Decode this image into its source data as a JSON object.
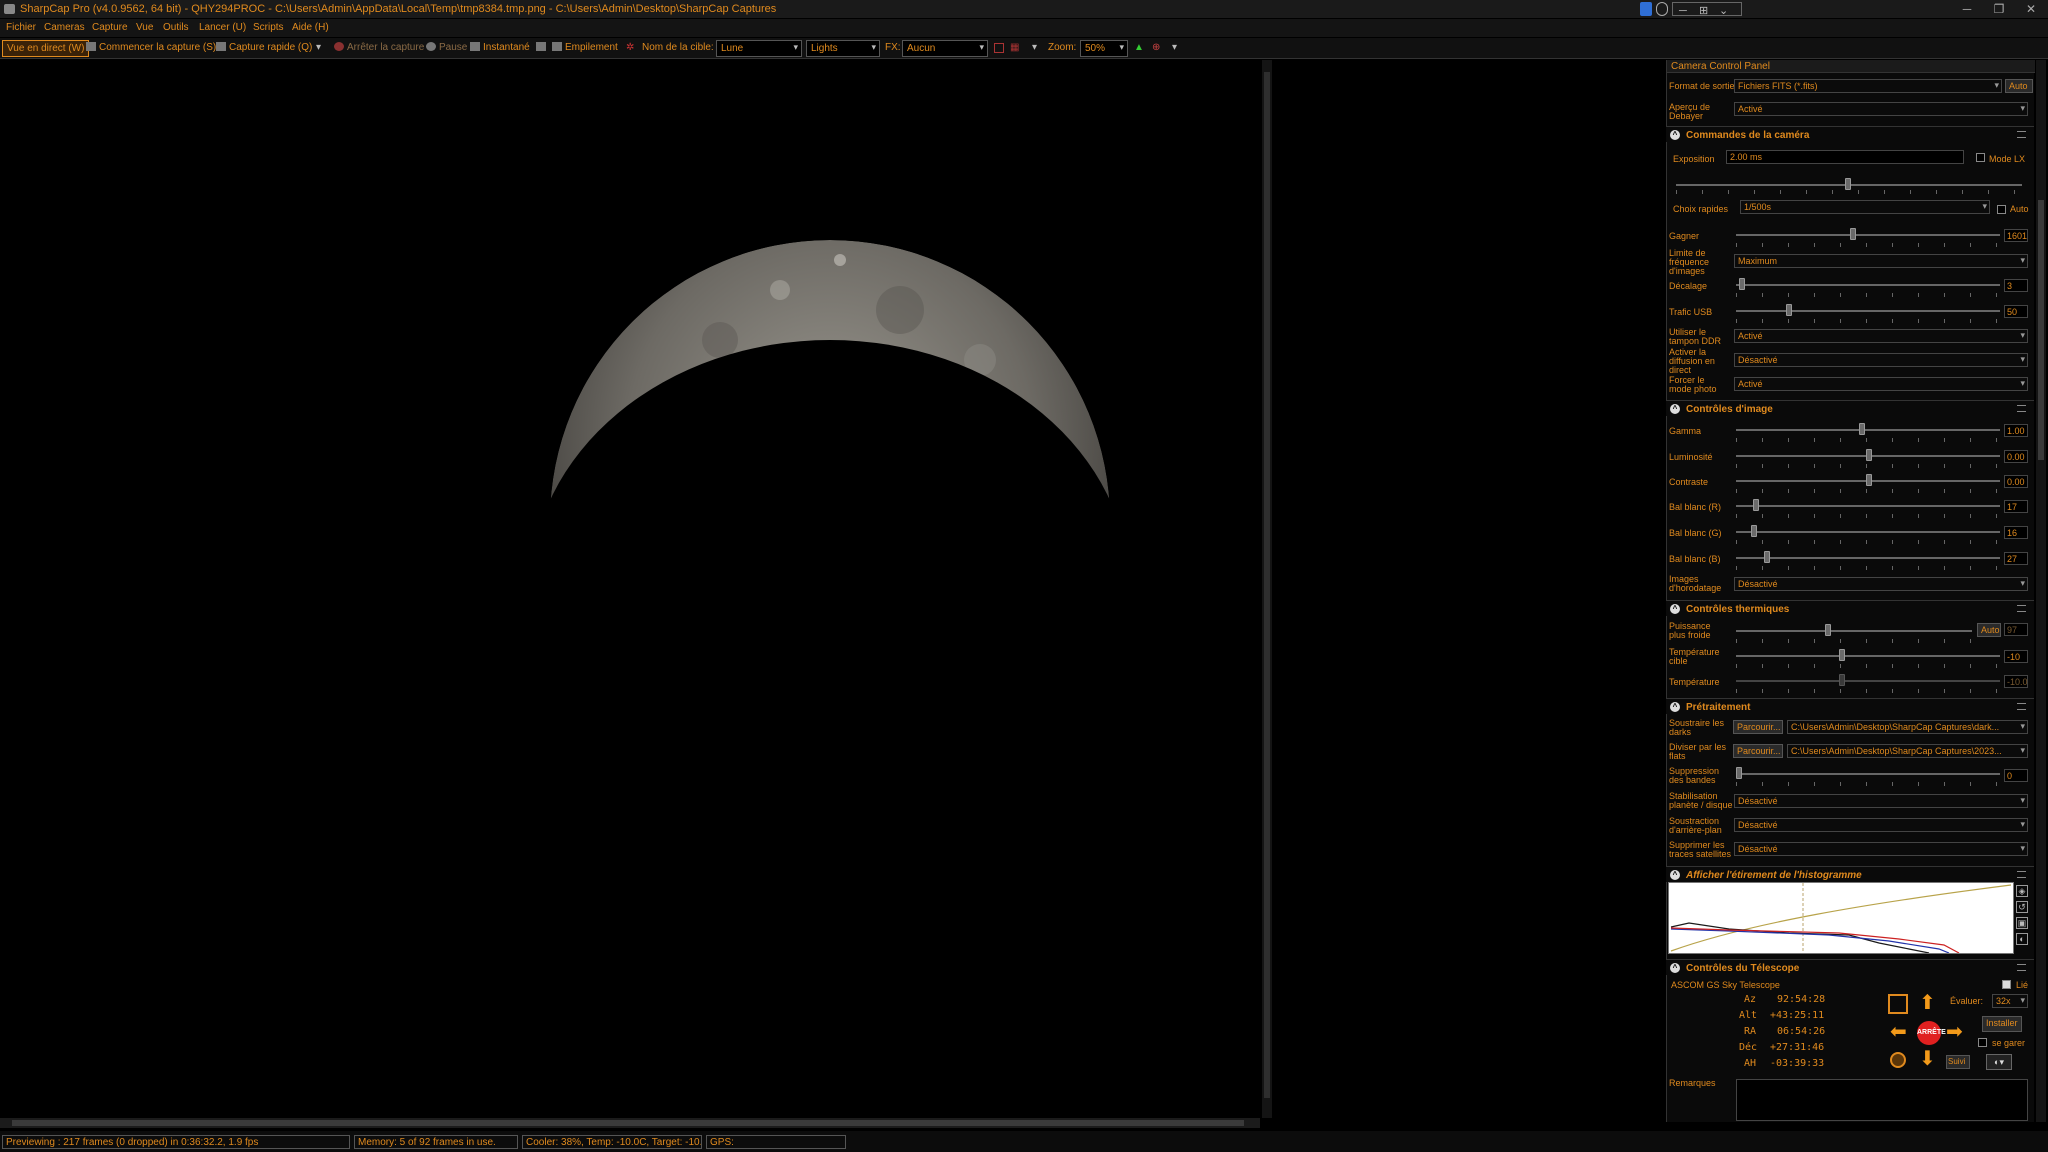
{
  "window": {
    "title": "SharpCap Pro (v4.0.9562, 64 bit) - QHY294PROC - C:\\Users\\Admin\\AppData\\Local\\Temp\\tmp8384.tmp.png - C:\\Users\\Admin\\Desktop\\SharpCap Captures"
  },
  "menu": [
    "Fichier",
    "Cameras",
    "Capture",
    "Vue",
    "Outils",
    "Lancer (U)",
    "Scripts",
    "Aide (H)"
  ],
  "toolbar": {
    "live": "Vue en direct (W)",
    "start": "Commencer la capture (S)",
    "quick": "Capture rapide (Q)",
    "stop": "Arrêter la capture",
    "pause": "Pause",
    "snapshot": "Instantané",
    "stack": "Empilement",
    "target_label": "Nom de la cible:",
    "target": "Lune",
    "frame_type": "Lights",
    "fx_label": "FX:",
    "fx": "Aucun",
    "zoom_label": "Zoom:",
    "zoom": "50%"
  },
  "status": {
    "preview": "Previewing : 217 frames (0 dropped) in 0:36:32.2, 1.9 fps",
    "memory": "Memory: 5 of 92 frames in use.",
    "cooler": "Cooler: 38%, Temp: -10.0C, Target: -10.0C",
    "gps": "GPS:"
  },
  "panel": {
    "title": "Camera Control Panel",
    "output_label": "Format de sortie",
    "output": "Fichiers FITS (*.fits)",
    "auto": "Auto",
    "debayer_label": "Aperçu de Debayer",
    "debayer": "Activé",
    "sec_camera": "Commandes de la caméra",
    "exposure_label": "Exposition",
    "exposure": "2.00 ms",
    "lx_label": "Mode LX",
    "quick_label": "Choix rapides",
    "quick": "1/500s",
    "quick_auto": "Auto",
    "gain_label": "Gagner",
    "gain": "1601",
    "fps_label": "Limite de fréquence d'images",
    "fps": "Maximum",
    "offset_label": "Décalage",
    "offset": "3",
    "usb_label": "Trafic USB",
    "usb": "50",
    "ddr_label": "Utiliser le tampon DDR",
    "ddr": "Activé",
    "stream_label": "Activer la diffusion en direct",
    "stream": "Désactivé",
    "photo_label": "Forcer le mode photo",
    "photo": "Activé",
    "sec_image": "Contrôles d'image",
    "gamma_label": "Gamma",
    "gamma": "1.00",
    "bright_label": "Luminosité",
    "bright": "0.00",
    "contrast_label": "Contraste",
    "contrast": "0.00",
    "wbr_label": "Bal blanc (R)",
    "wbr": "17",
    "wbg_label": "Bal blanc (G)",
    "wbg": "16",
    "wbb_label": "Bal blanc (B)",
    "wbb": "27",
    "ts_label": "Images d'horodatage",
    "ts": "Désactivé",
    "sec_thermal": "Contrôles thermiques",
    "cooler_label": "Puissance plus froide",
    "cooler_auto": "Auto",
    "cooler": "97",
    "target_label": "Température cible",
    "target": "-10",
    "temp_label": "Température",
    "temp": "-10.0",
    "sec_pre": "Prétraitement",
    "darks_label": "Soustraire les darks",
    "browse": "Parcourir...",
    "darks": "C:\\Users\\Admin\\Desktop\\SharpCap Captures\\dark...",
    "flats_label": "Diviser par les flats",
    "flats": "C:\\Users\\Admin\\Desktop\\SharpCap Captures\\2023...",
    "banding_label": "Suppression des bandes",
    "banding": "0",
    "stab_label": "Stabilisation planète / disque",
    "stab": "Désactivé",
    "bg_label": "Soustraction d'arrière-plan",
    "bg": "Désactivé",
    "sat_label": "Supprimer les traces satellites",
    "sat": "Désactivé",
    "sec_hist": "Afficher l'étirement de l'histogramme",
    "sec_tele": "Contrôles du Télescope",
    "mount": "ASCOM GS Sky Telescope",
    "linked": "Lié",
    "az_label": "Az",
    "az": "92:54:28",
    "alt_label": "Alt",
    "alt": "+43:25:11",
    "ra_label": "RA",
    "ra": "06:54:26",
    "dec_label": "Déc",
    "dec": "+27:31:46",
    "ah_label": "AH",
    "ah": "-03:39:33",
    "rate_label": "Évaluer:",
    "rate": "32x",
    "stop": "ARRÊTE",
    "install": "Installer",
    "park": "se garer",
    "track": "Suivi",
    "notes_label": "Remarques"
  }
}
